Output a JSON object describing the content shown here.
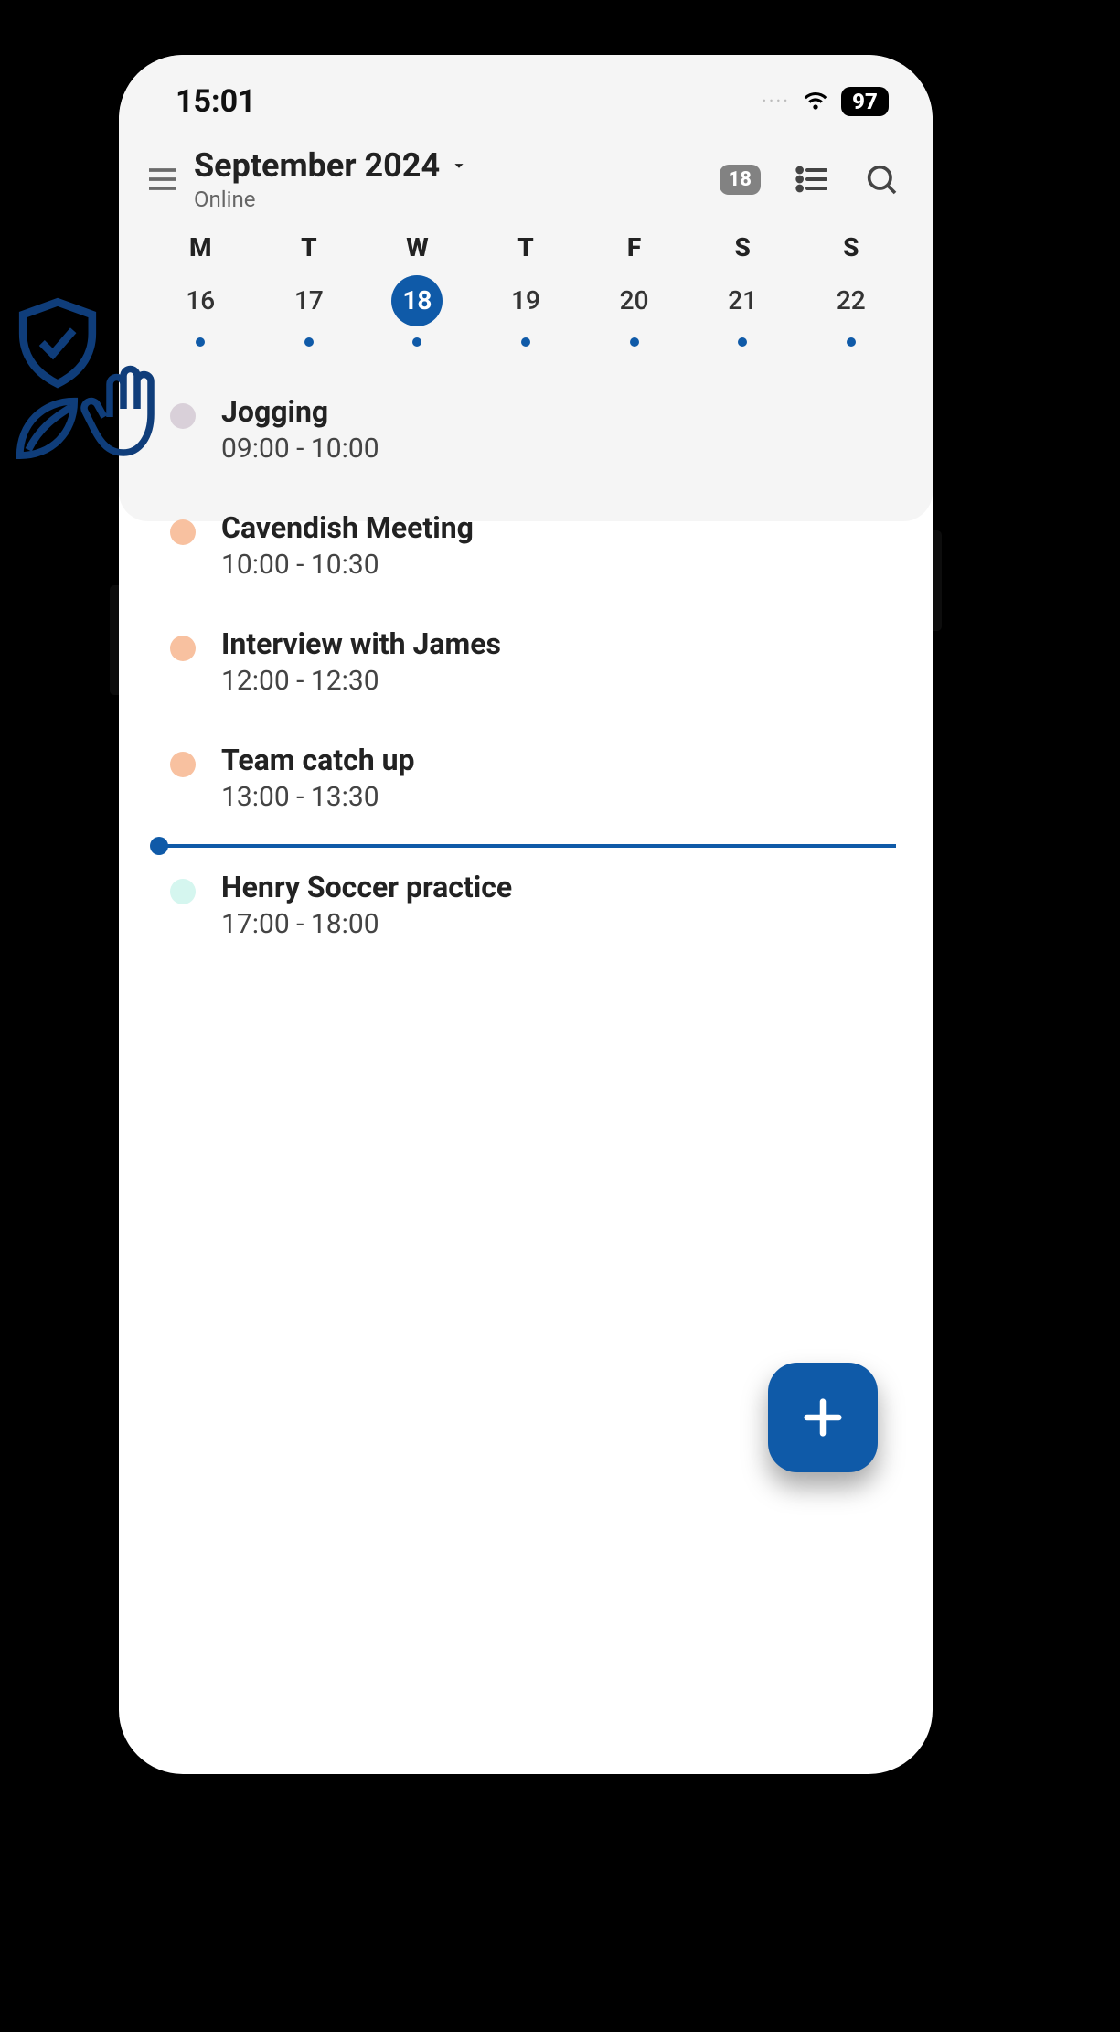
{
  "status": {
    "time": "15:01",
    "battery": "97"
  },
  "header": {
    "month_title": "September 2024",
    "subtitle": "Online",
    "date_chip": "18"
  },
  "week": {
    "labels": [
      "M",
      "T",
      "W",
      "T",
      "F",
      "S",
      "S"
    ],
    "dates": [
      "16",
      "17",
      "18",
      "19",
      "20",
      "21",
      "22"
    ],
    "selected_index": 2
  },
  "events": [
    {
      "title": "Jogging",
      "time": "09:00 - 10:00",
      "color": "#d9d0d9"
    },
    {
      "title": "Cavendish Meeting",
      "time": "10:00 - 10:30",
      "color": "#f8c1a0"
    },
    {
      "title": "Interview with James",
      "time": "12:00 - 12:30",
      "color": "#f8c1a0"
    },
    {
      "title": "Team catch up",
      "time": "13:00 - 13:30",
      "color": "#f8c1a0"
    },
    {
      "title": "Henry Soccer practice",
      "time": "17:00 - 18:00",
      "color": "#d5f6ef"
    }
  ],
  "now_after_index": 3,
  "colors": {
    "primary": "#0f5aa8"
  }
}
